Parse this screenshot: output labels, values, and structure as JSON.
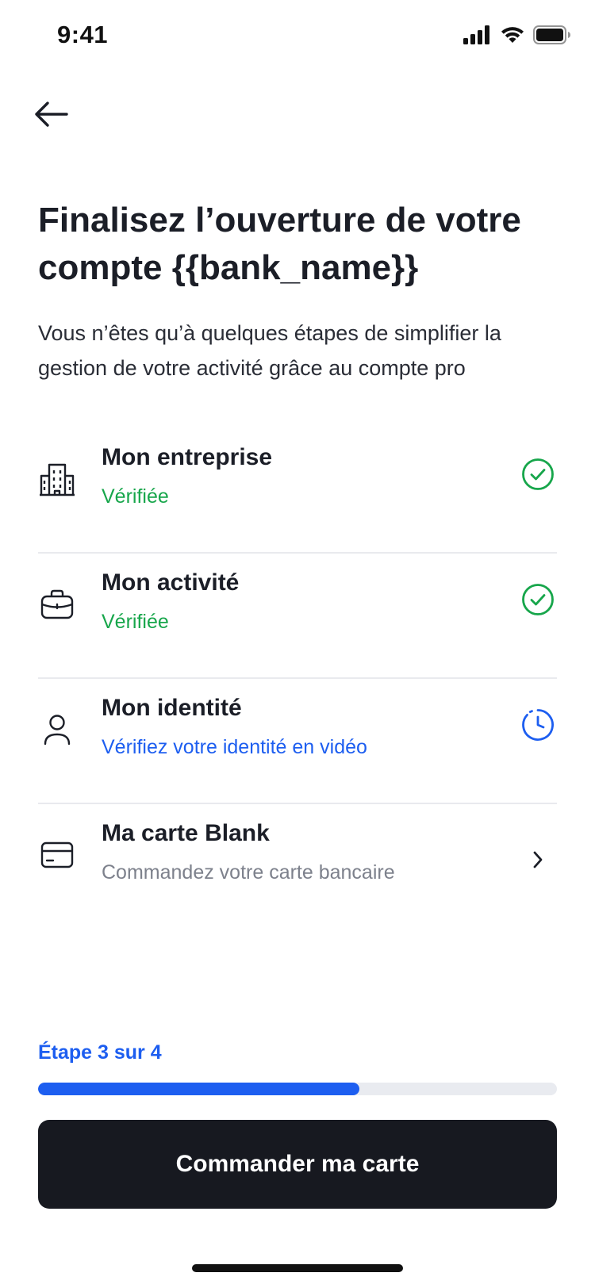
{
  "status_bar": {
    "time": "9:41",
    "icons": [
      "cellular-signal-icon",
      "wifi-icon",
      "battery-icon"
    ]
  },
  "header": {
    "back_icon": "arrow-left-icon",
    "title": "Finalisez l’ouverture de votre compte {{bank_name}}",
    "subtitle": "Vous n’êtes qu’à quelques étapes de simplifier la gestion de votre activité grâce au compte pro"
  },
  "steps": [
    {
      "icon": "building-icon",
      "title": "Mon entreprise",
      "status": "Vérifiée",
      "state": "done",
      "trailing_icon": "check-circle-icon"
    },
    {
      "icon": "briefcase-icon",
      "title": "Mon activité",
      "status": "Vérifiée",
      "state": "done",
      "trailing_icon": "check-circle-icon"
    },
    {
      "icon": "user-icon",
      "title": "Mon identité",
      "status": "Vérifiez votre identité en vidéo",
      "state": "pending",
      "trailing_icon": "clock-icon"
    },
    {
      "icon": "credit-card-icon",
      "title": "Ma carte Blank",
      "status": "Commandez votre carte bancaire",
      "state": "todo",
      "trailing_icon": "chevron-right-icon"
    }
  ],
  "progress": {
    "label": "Étape 3 sur 4",
    "current_step": 3,
    "total_steps": 4,
    "fill_fraction": 0.62
  },
  "cta": {
    "label": "Commander ma carte"
  },
  "colors": {
    "primary_text": "#1b1e27",
    "verified_green": "#17a64b",
    "action_blue": "#1d5ef0",
    "muted_gray": "#7d818c",
    "cta_background": "#171920",
    "progress_track": "#e9ebf0"
  }
}
